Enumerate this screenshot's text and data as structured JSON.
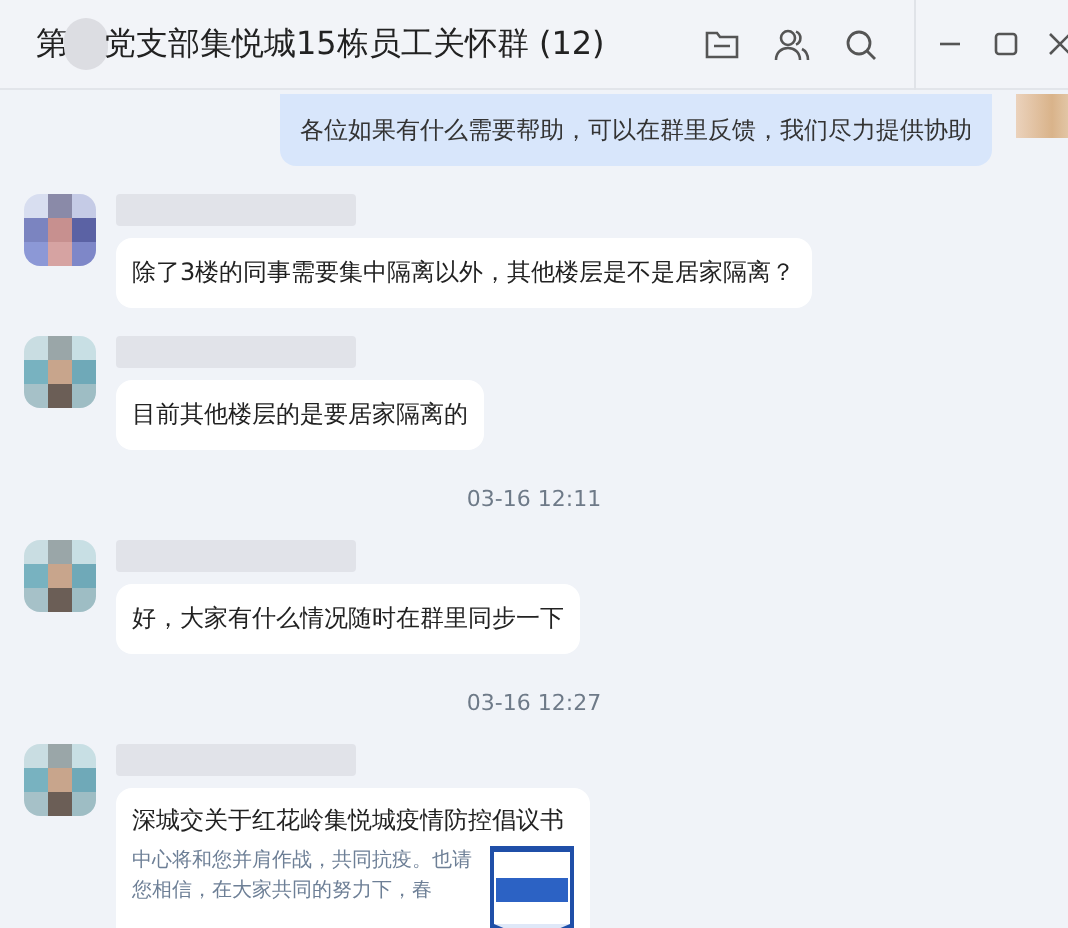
{
  "header": {
    "title_start": "第",
    "title_rest": "党支部集悦城15栋员工关怀群 (12)"
  },
  "messages": [
    {
      "kind": "outgoing",
      "text": "各位如果有什么需要帮助，可以在群里反馈，我们尽力提供协助"
    },
    {
      "kind": "incoming",
      "text": "除了3楼的同事需要集中隔离以外，其他楼层是不是居家隔离？"
    },
    {
      "kind": "incoming",
      "text": "目前其他楼层的是要居家隔离的"
    },
    {
      "kind": "time",
      "text": "03-16 12:11"
    },
    {
      "kind": "incoming",
      "text": "好，大家有什么情况随时在群里同步一下"
    },
    {
      "kind": "time",
      "text": "03-16 12:27"
    },
    {
      "kind": "card",
      "title": "深城交关于红花岭集悦城疫情防控倡议书",
      "desc": "中心将和您并肩作战，共同抗疫。也请您相信，在大家共同的努力下，春"
    }
  ]
}
